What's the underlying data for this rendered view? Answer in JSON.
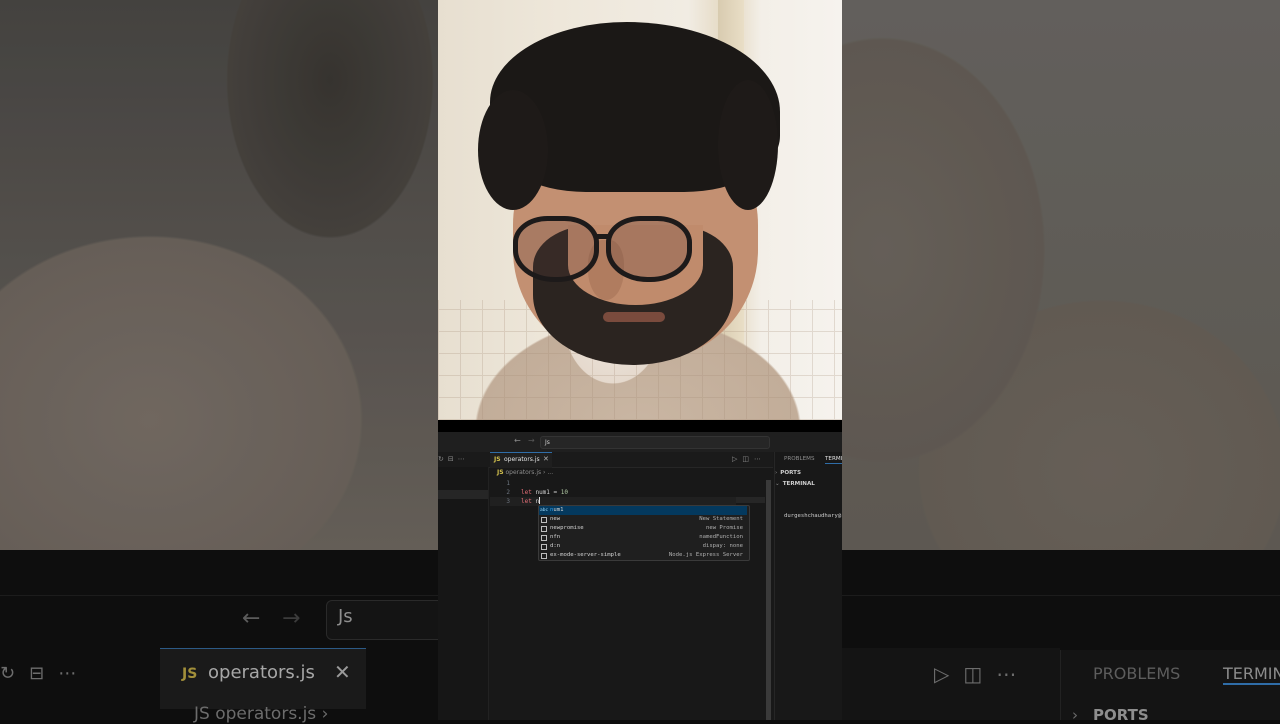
{
  "editor": {
    "command_center": "Js",
    "tab": {
      "badge": "JS",
      "name": "operators.js",
      "close": "✕"
    },
    "breadcrumb": {
      "badge": "JS",
      "file": "operators.js",
      "sep": "›",
      "more": "..."
    },
    "line_numbers": [
      "1",
      "2",
      "3"
    ],
    "code": {
      "line2": {
        "kw": "let",
        "rest": " num1 = ",
        "num": "10"
      },
      "line3": {
        "kw": "let",
        "rest": " n"
      }
    },
    "suggestions": [
      {
        "icon": "abc",
        "match": "n",
        "rest": "um1",
        "detail": ""
      },
      {
        "icon": "□",
        "match": "",
        "rest": "new",
        "detail": "New Statement"
      },
      {
        "icon": "□",
        "match": "",
        "rest": "newpromise",
        "detail": "new Promise"
      },
      {
        "icon": "□",
        "match": "",
        "rest": "nfn",
        "detail": "namedFunction"
      },
      {
        "icon": "□",
        "match": "",
        "rest": "d:n",
        "detail": "dispay: none"
      },
      {
        "icon": "□",
        "match": "",
        "rest": "ex-mode-server-simple",
        "detail": "Node.js Express Server"
      }
    ],
    "panel": {
      "tab_problems": "PROBLEMS",
      "tab_terminal": "TERMI",
      "section_ports": "PORTS",
      "section_terminal": "TERMINAL",
      "terminal_line": "durgeshchaudhary@"
    }
  },
  "background": {
    "command_center": "Js",
    "tab_badge": "JS",
    "tab_name": "operators.js",
    "tab_close": "✕",
    "breadcrumb": "JS operators.js ›",
    "panel_problems": "PROBLEMS",
    "panel_terminal": "TERMIN",
    "panel_ports": "PORTS"
  },
  "icons": {
    "back": "←",
    "forward": "→",
    "chevron_right": "›",
    "chevron_down": "⌄",
    "run": "▷",
    "split": "◫",
    "more": "⋯",
    "refresh": "↻",
    "collapse": "⊟"
  },
  "colors": {
    "accent": "#2f6da8",
    "js_badge": "#d6c44f",
    "keyword": "#e06c75",
    "number": "#b5cea8",
    "match": "#2aa0f2"
  }
}
